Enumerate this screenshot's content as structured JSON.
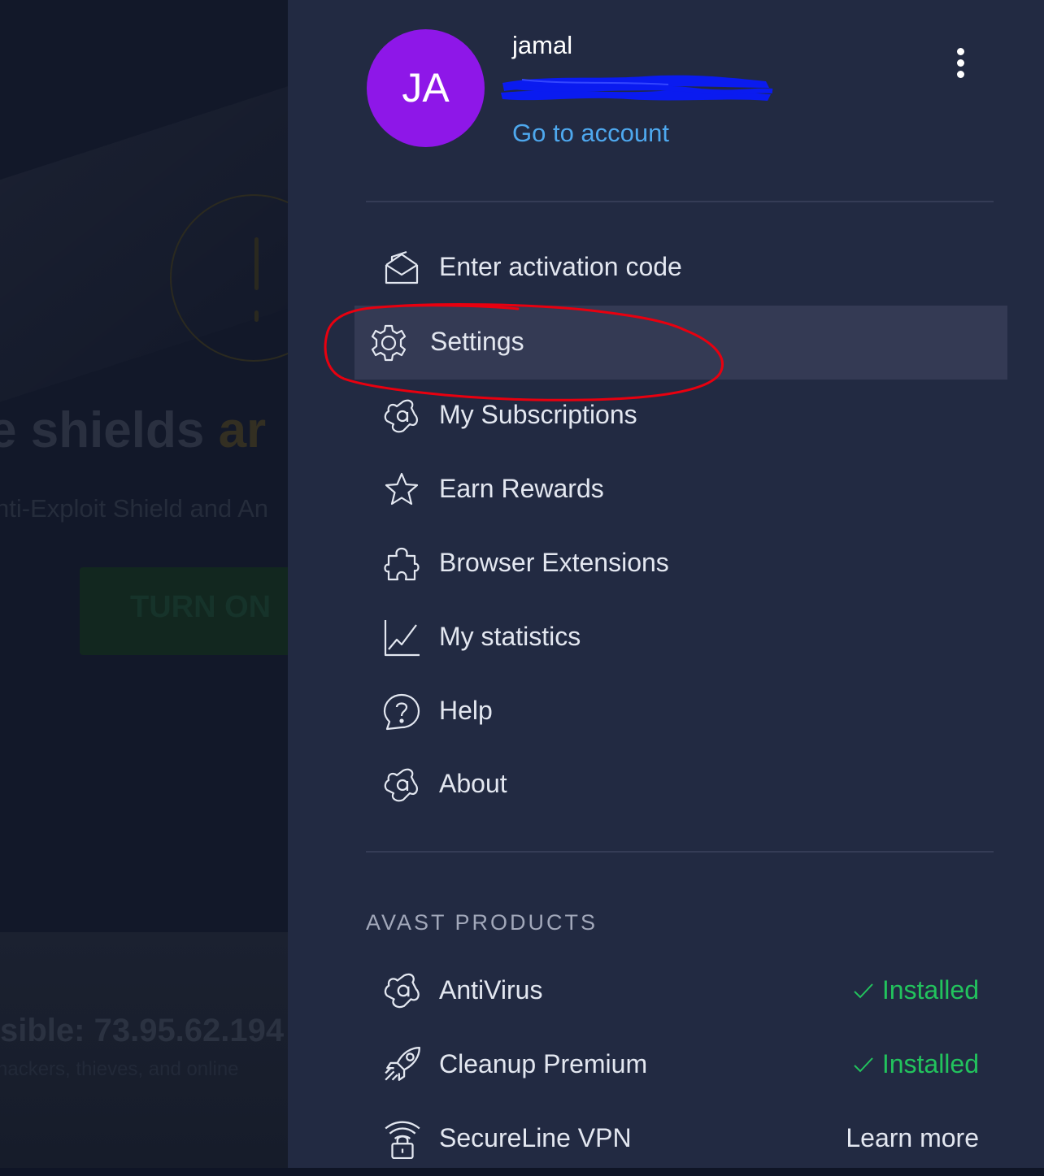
{
  "background": {
    "headline_part": "e shields ",
    "headline_warn": "ar",
    "subtitle": "nti-Exploit Shield and An",
    "turn_on_button": "TURN ON",
    "ip_line": "sible: 73.95.62.194",
    "small_line": "hackers, thieves, and online"
  },
  "account": {
    "avatar_initials": "JA",
    "name": "jamal",
    "go_to_account": "Go to account"
  },
  "menu": {
    "items": [
      {
        "label": "Enter activation code",
        "icon": "envelope-open-icon"
      },
      {
        "label": "Settings",
        "icon": "gear-icon",
        "active": true
      },
      {
        "label": "My Subscriptions",
        "icon": "avast-logo-icon"
      },
      {
        "label": "Earn Rewards",
        "icon": "star-icon"
      },
      {
        "label": "Browser Extensions",
        "icon": "puzzle-icon"
      },
      {
        "label": "My statistics",
        "icon": "chart-line-icon"
      },
      {
        "label": "Help",
        "icon": "help-icon"
      },
      {
        "label": "About",
        "icon": "avast-logo-icon"
      }
    ]
  },
  "products": {
    "title": "AVAST PRODUCTS",
    "items": [
      {
        "name": "AntiVirus",
        "status": "Installed",
        "icon": "avast-logo-icon"
      },
      {
        "name": "Cleanup Premium",
        "status": "Installed",
        "icon": "rocket-icon"
      },
      {
        "name": "SecureLine VPN",
        "action": "Learn more",
        "icon": "vpn-lock-icon"
      }
    ]
  },
  "colors": {
    "panel_bg": "#222a42",
    "avatar_bg": "#8e17e8",
    "link": "#4ea8ee",
    "installed_green": "#22c35d",
    "active_item_bg": "#343a54",
    "annotation_red": "#e8000f",
    "redaction_blue": "#0a1bf0"
  }
}
